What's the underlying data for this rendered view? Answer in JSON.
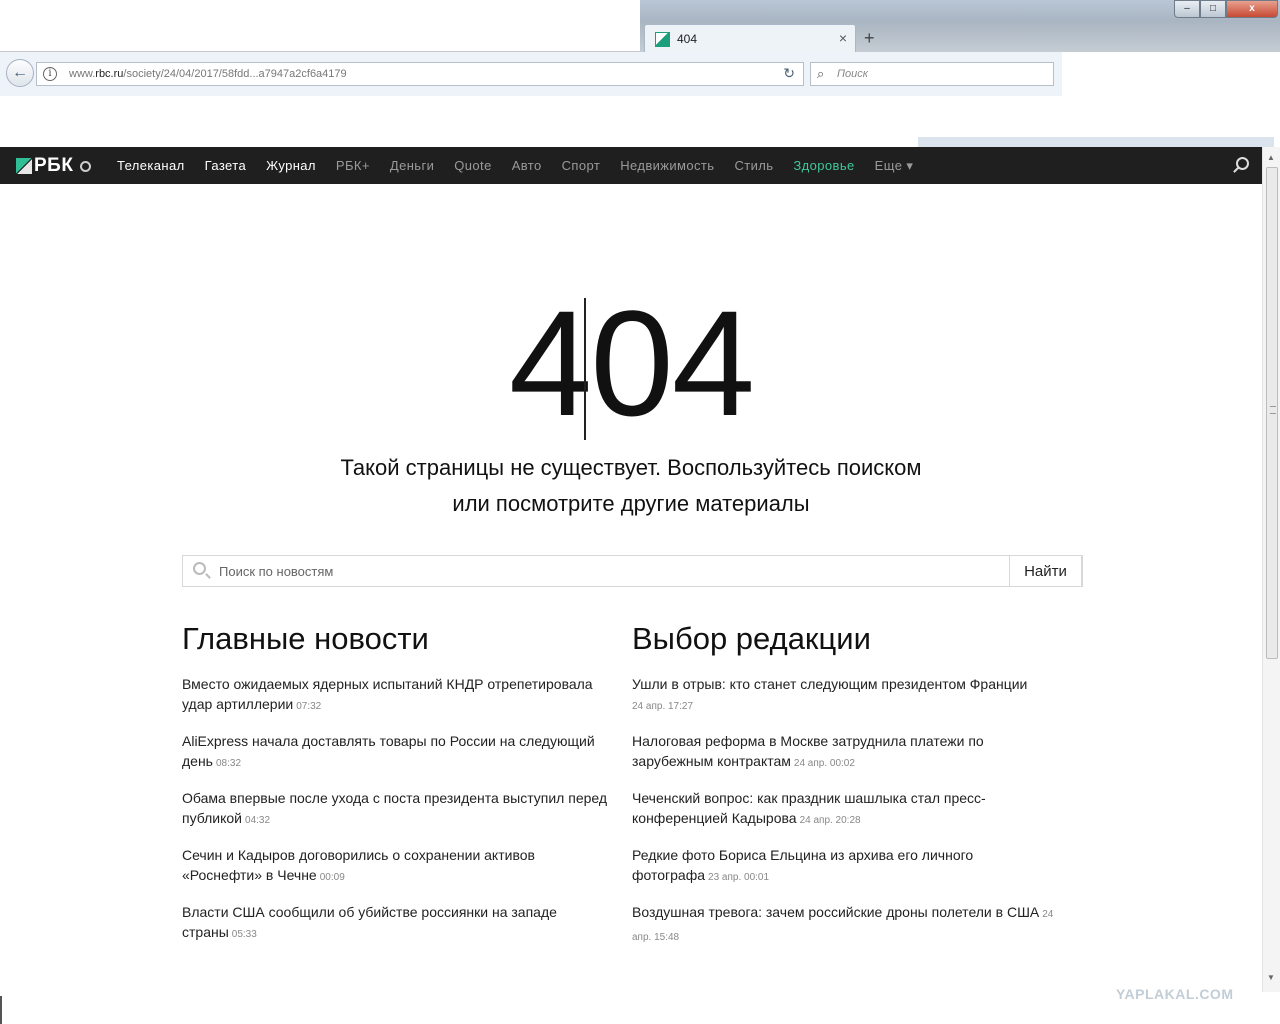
{
  "browser": {
    "tab_title": "404",
    "tab_close": "×",
    "new_tab": "+",
    "win_minimize": "–",
    "win_maximize": "□",
    "win_close": "x",
    "back": "←",
    "info": "i",
    "url_prefix": "www.",
    "url_host": "rbc.ru",
    "url_path": "/society/24/04/2017/58fdd...a7947a2cf6a4179",
    "reload": "↻",
    "search_icon": "⌕",
    "search_placeholder": "Поиск"
  },
  "site": {
    "logo_text": "РБК",
    "nav": [
      {
        "label": "Телеканал",
        "style": "bright"
      },
      {
        "label": "Газета",
        "style": "bright"
      },
      {
        "label": "Журнал",
        "style": "bright"
      },
      {
        "label": "РБК+",
        "style": "dim"
      },
      {
        "label": "Деньги",
        "style": "dim"
      },
      {
        "label": "Quote",
        "style": "dim"
      },
      {
        "label": "Авто",
        "style": "dim"
      },
      {
        "label": "Спорт",
        "style": "dim"
      },
      {
        "label": "Недвижимость",
        "style": "dim"
      },
      {
        "label": "Стиль",
        "style": "dim"
      },
      {
        "label": "Здоровье",
        "style": "green"
      },
      {
        "label": "Еще ▾",
        "style": "dim"
      }
    ],
    "colors": {
      "header_bg": "#1f1f1f",
      "accent_green": "#40c69a"
    }
  },
  "error": {
    "code": "404",
    "message_line1": "Такой страницы не существует. Воспользуйтесь поиском",
    "message_line2": "или посмотрите другие материалы"
  },
  "search": {
    "placeholder": "Поиск по новостям",
    "button": "Найти"
  },
  "main_news": {
    "title": "Главные новости",
    "items": [
      {
        "text": "Вместо ожидаемых ядерных испытаний КНДР отрепетировала удар артиллерии",
        "time": "07:32"
      },
      {
        "text": "AliExpress начала доставлять товары по России на следующий день",
        "time": "08:32"
      },
      {
        "text": "Обама впервые после ухода с поста президента выступил перед публикой",
        "time": "04:32"
      },
      {
        "text": "Сечин и Кадыров договорились о сохранении активов «Роснефти» в Чечне",
        "time": "00:09"
      },
      {
        "text": "Власти США сообщили об убийстве россиянки на западе страны",
        "time": "05:33"
      }
    ]
  },
  "editor_choice": {
    "title": "Выбор редакции",
    "items": [
      {
        "text": "Ушли в отрыв: кто станет следующим президентом Франции",
        "time": "24 апр. 17:27",
        "block_time": true
      },
      {
        "text": "Налоговая реформа в Москве затруднила платежи по зарубежным контрактам",
        "time": "24 апр. 00:02"
      },
      {
        "text": "Чеченский вопрос: как праздник шашлыка стал пресс-конференцией Кадырова",
        "time": "24 апр. 20:28"
      },
      {
        "text": "Редкие фото Бориса Ельцина из архива его личного фотографа",
        "time": "23 апр. 00:01"
      },
      {
        "text": "Воздушная тревога: зачем российские дроны полетели в США",
        "time": "24 апр. 15:48"
      }
    ]
  },
  "watermark": "YAPLAKAL.COM"
}
